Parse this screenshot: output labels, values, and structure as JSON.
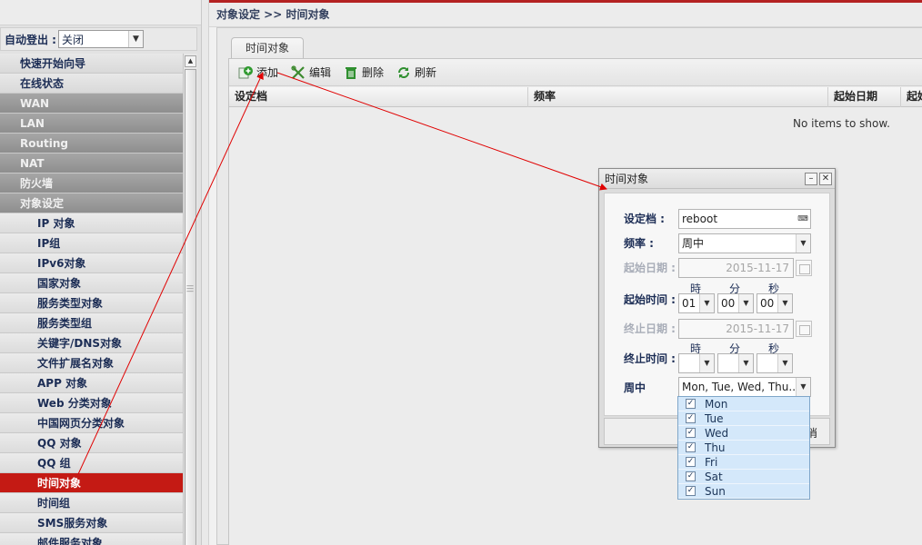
{
  "sidebar": {
    "auto_logout_label": "自动登出 :",
    "auto_logout_value": "关闭",
    "menu": [
      {
        "label": "快速开始向导",
        "kind": "top"
      },
      {
        "label": "在线状态",
        "kind": "top"
      },
      {
        "label": "WAN",
        "kind": "grp"
      },
      {
        "label": "LAN",
        "kind": "grp"
      },
      {
        "label": "Routing",
        "kind": "grp"
      },
      {
        "label": "NAT",
        "kind": "grp"
      },
      {
        "label": "防火墙",
        "kind": "grp"
      },
      {
        "label": "对象设定",
        "kind": "grp"
      },
      {
        "label": "IP 对象",
        "kind": "sub"
      },
      {
        "label": "IP组",
        "kind": "sub"
      },
      {
        "label": "IPv6对象",
        "kind": "sub"
      },
      {
        "label": "国家对象",
        "kind": "sub"
      },
      {
        "label": "服务类型对象",
        "kind": "sub"
      },
      {
        "label": "服务类型组",
        "kind": "sub"
      },
      {
        "label": "关键字/DNS对象",
        "kind": "sub"
      },
      {
        "label": "文件扩展名对象",
        "kind": "sub"
      },
      {
        "label": "APP 对象",
        "kind": "sub"
      },
      {
        "label": "Web 分类对象",
        "kind": "sub"
      },
      {
        "label": "中国网页分类对象",
        "kind": "sub"
      },
      {
        "label": "QQ 对象",
        "kind": "sub"
      },
      {
        "label": "QQ 组",
        "kind": "sub"
      },
      {
        "label": "时间对象",
        "kind": "sub",
        "active": true
      },
      {
        "label": "时间组",
        "kind": "sub"
      },
      {
        "label": "SMS服务对象",
        "kind": "sub"
      },
      {
        "label": "邮件服务对象",
        "kind": "sub"
      }
    ]
  },
  "main": {
    "breadcrumb": "对象设定 >> 时间对象",
    "tab_label": "时间对象",
    "toolbar": {
      "add": "添加",
      "edit": "编辑",
      "delete": "删除",
      "refresh": "刷新"
    },
    "columns": [
      "设定档",
      "频率",
      "起始日期",
      "起始"
    ],
    "empty_text": "No items to show."
  },
  "dialog": {
    "title": "时间对象",
    "minimize_icon": "minus-icon",
    "close_icon": "close-icon",
    "profile_label": "设定档 :",
    "profile_value": "reboot",
    "frequency_label": "频率 :",
    "frequency_value": "周中",
    "start_date_label": "起始日期 :",
    "start_date_value": "2015-11-17",
    "start_time_label": "起始时间 :",
    "hour_label": "時",
    "minute_label": "分",
    "second_label": "秒",
    "start_hour": "01",
    "start_minute": "00",
    "start_second": "00",
    "end_date_label": "终止日期 :",
    "end_date_value": "2015-11-17",
    "end_time_label": "终止时间 :",
    "end_hour": "",
    "end_minute": "",
    "end_second": "",
    "weekdays_label": "周中",
    "weekdays_value": "Mon, Tue, Wed, Thu...",
    "cancel_partial": "消",
    "days": [
      {
        "label": "Mon",
        "checked": true
      },
      {
        "label": "Tue",
        "checked": true
      },
      {
        "label": "Wed",
        "checked": true
      },
      {
        "label": "Thu",
        "checked": true
      },
      {
        "label": "Fri",
        "checked": true
      },
      {
        "label": "Sat",
        "checked": true
      },
      {
        "label": "Sun",
        "checked": true
      }
    ]
  },
  "colors": {
    "active_menu": "#c41a14",
    "annotation_arrow": "#e00000"
  }
}
